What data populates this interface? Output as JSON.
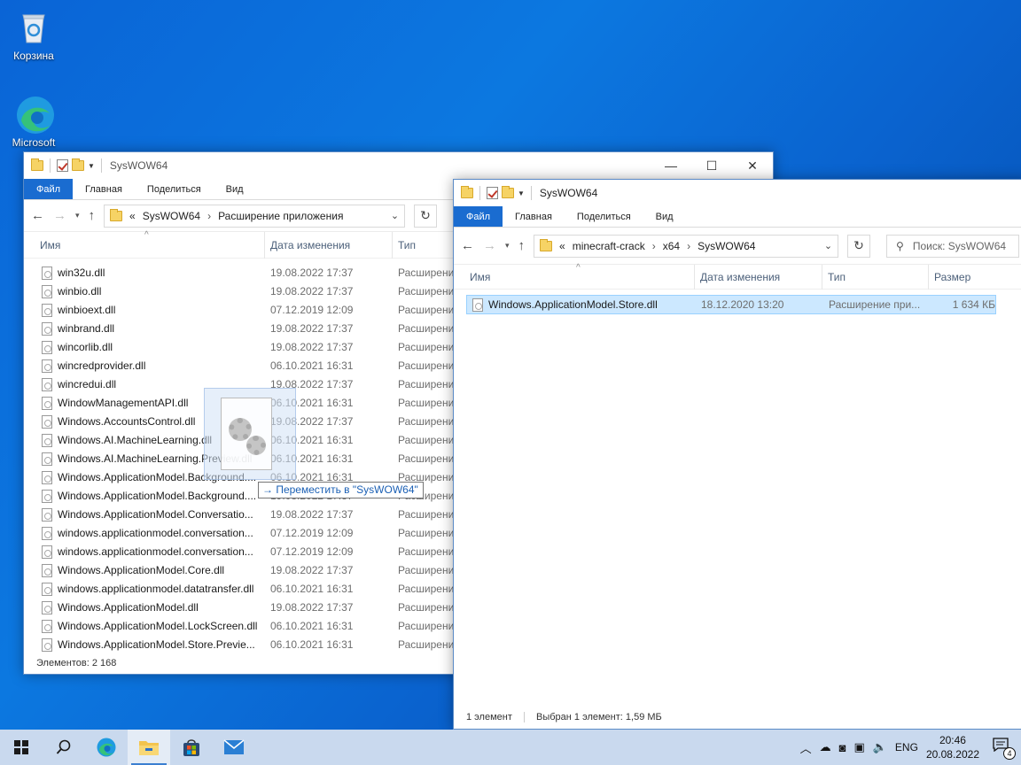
{
  "desktop": {
    "recycle_label": "Корзина",
    "edge_label": "Microsoft"
  },
  "left_window": {
    "title": "SysWOW64",
    "tabs": [
      "Файл",
      "Главная",
      "Поделиться",
      "Вид"
    ],
    "address": {
      "prefix": "«",
      "parts": [
        "SysWOW64",
        "Расширение приложения"
      ],
      "sep": "›"
    },
    "columns": [
      "Имя",
      "Дата изменения",
      "Тип"
    ],
    "rows": [
      {
        "name": "win32u.dll",
        "date": "19.08.2022 17:37",
        "type": "Расширени"
      },
      {
        "name": "winbio.dll",
        "date": "19.08.2022 17:37",
        "type": "Расширени"
      },
      {
        "name": "winbioext.dll",
        "date": "07.12.2019 12:09",
        "type": "Расширени"
      },
      {
        "name": "winbrand.dll",
        "date": "19.08.2022 17:37",
        "type": "Расширени"
      },
      {
        "name": "wincorlib.dll",
        "date": "19.08.2022 17:37",
        "type": "Расширени"
      },
      {
        "name": "wincredprovider.dll",
        "date": "06.10.2021 16:31",
        "type": "Расширени"
      },
      {
        "name": "wincredui.dll",
        "date": "19.08.2022 17:37",
        "type": "Расширени"
      },
      {
        "name": "WindowManagementAPI.dll",
        "date": "06.10.2021 16:31",
        "type": "Расширени"
      },
      {
        "name": "Windows.AccountsControl.dll",
        "date": "19.08.2022 17:37",
        "type": "Расширени"
      },
      {
        "name": "Windows.AI.MachineLearning.dll",
        "date": "06.10.2021 16:31",
        "type": "Расширени"
      },
      {
        "name": "Windows.AI.MachineLearning.Preview.dll",
        "date": "06.10.2021 16:31",
        "type": "Расширени"
      },
      {
        "name": "Windows.ApplicationModel.Background....",
        "date": "06.10.2021 16:31",
        "type": "Расширени"
      },
      {
        "name": "Windows.ApplicationModel.Background....",
        "date": "19.08.2022 17:37",
        "type": "Расширени"
      },
      {
        "name": "Windows.ApplicationModel.Conversatio...",
        "date": "19.08.2022 17:37",
        "type": "Расширени"
      },
      {
        "name": "windows.applicationmodel.conversation...",
        "date": "07.12.2019 12:09",
        "type": "Расширени"
      },
      {
        "name": "windows.applicationmodel.conversation...",
        "date": "07.12.2019 12:09",
        "type": "Расширени"
      },
      {
        "name": "Windows.ApplicationModel.Core.dll",
        "date": "19.08.2022 17:37",
        "type": "Расширени"
      },
      {
        "name": "windows.applicationmodel.datatransfer.dll",
        "date": "06.10.2021 16:31",
        "type": "Расширени"
      },
      {
        "name": "Windows.ApplicationModel.dll",
        "date": "19.08.2022 17:37",
        "type": "Расширени"
      },
      {
        "name": "Windows.ApplicationModel.LockScreen.dll",
        "date": "06.10.2021 16:31",
        "type": "Расширени"
      },
      {
        "name": "Windows.ApplicationModel.Store.Previe...",
        "date": "06.10.2021 16:31",
        "type": "Расширени"
      }
    ],
    "status": "Элементов: 2 168"
  },
  "right_window": {
    "title": "SysWOW64",
    "tabs": [
      "Файл",
      "Главная",
      "Поделиться",
      "Вид"
    ],
    "address": {
      "prefix": "«",
      "parts": [
        "minecraft-crack",
        "x64",
        "SysWOW64"
      ],
      "sep": "›"
    },
    "search_placeholder": "Поиск: SysWOW64",
    "columns": [
      "Имя",
      "Дата изменения",
      "Тип",
      "Размер"
    ],
    "rows": [
      {
        "name": "Windows.ApplicationModel.Store.dll",
        "date": "18.12.2020 13:20",
        "type": "Расширение при...",
        "size": "1 634 КБ",
        "selected": true
      }
    ],
    "status_count": "1 элемент",
    "status_selected": "Выбран 1 элемент: 1,59 МБ"
  },
  "drag_tooltip": "→ Переместить в \"SysWOW64\"",
  "taskbar": {
    "lang": "ENG",
    "time": "20:46",
    "date": "20.08.2022",
    "notif_count": "4"
  }
}
